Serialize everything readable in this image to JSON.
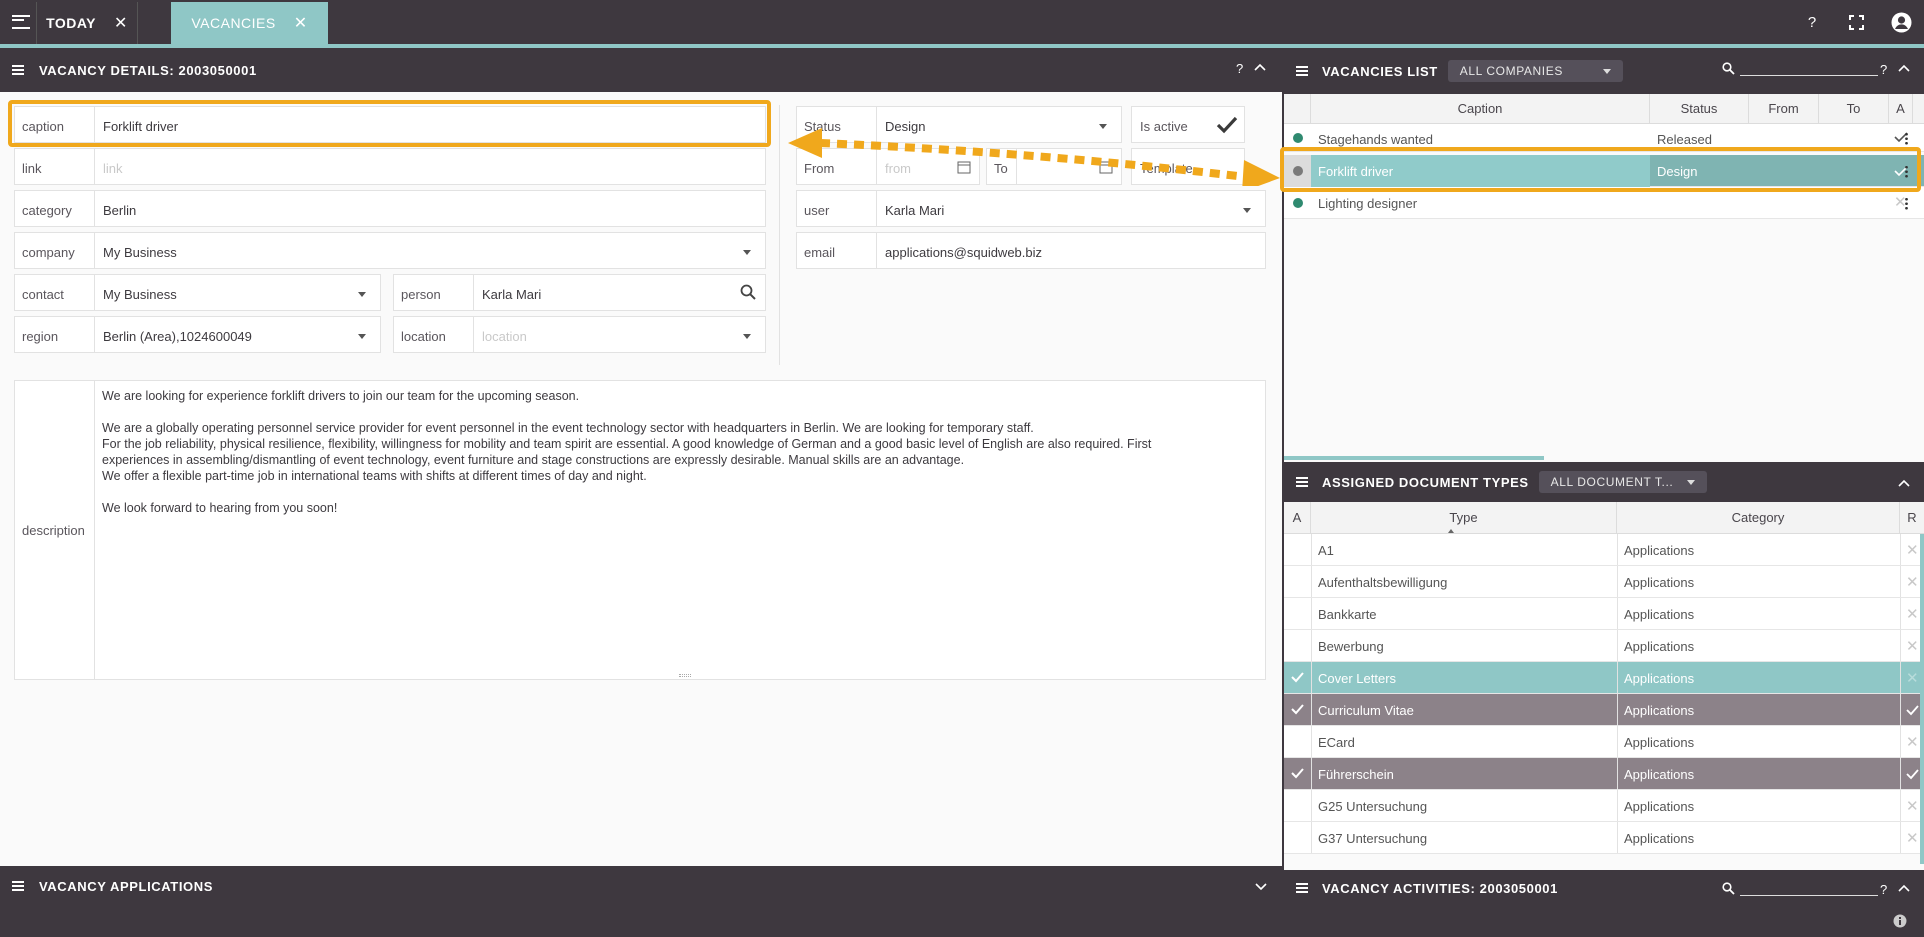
{
  "tabs": [
    {
      "label": "TODAY",
      "close": "✕",
      "active": false
    },
    {
      "label": "VACANCIES",
      "close": "✕",
      "active": true
    }
  ],
  "topbar": {
    "help": "?"
  },
  "details": {
    "title": "VACANCY DETAILS: 2003050001",
    "help": "?",
    "fields": {
      "caption": {
        "label": "caption",
        "value": "Forklift driver"
      },
      "link": {
        "label": "link",
        "placeholder": "link"
      },
      "category": {
        "label": "category",
        "value": "Berlin"
      },
      "company": {
        "label": "company",
        "value": "My Business"
      },
      "contact": {
        "label": "contact",
        "value": "My Business"
      },
      "person": {
        "label": "person",
        "value": "Karla Mari"
      },
      "region": {
        "label": "region",
        "value": "Berlin (Area),1024600049"
      },
      "location": {
        "label": "location",
        "placeholder": "location"
      },
      "status": {
        "label": "Status",
        "value": "Design"
      },
      "is_active": {
        "label": "Is active"
      },
      "from": {
        "label": "From",
        "placeholder": "from"
      },
      "to": {
        "label": "To"
      },
      "template": {
        "label": "Template"
      },
      "user": {
        "label": "user",
        "value": "Karla Mari"
      },
      "email": {
        "label": "email",
        "value": "applications@squidweb.biz"
      },
      "description": {
        "label": "description",
        "lines": [
          "We are looking for experience forklift drivers to join our team for the upcoming season.",
          "",
          "We are a globally operating personnel service provider for event personnel in the event technology sector with headquarters in Berlin. We are looking for temporary staff.",
          "For the job reliability, physical resilience, flexibility, willingness for mobility and team spirit are essential. A good knowledge of German and a good basic level of English are also required. First",
          "experiences in assembling/dismantling of event technology, event furniture and stage constructions are expressly desirable. Manual skills are an advantage.",
          "We offer a flexible part-time job in international teams with shifts at different times of day and night.",
          "",
          "We look forward to hearing from you soon!"
        ]
      }
    }
  },
  "applications": {
    "title": "VACANCY APPLICATIONS"
  },
  "vacancies": {
    "title": "VACANCIES LIST",
    "filter": "ALL COMPANIES",
    "help": "?",
    "columns": [
      "Caption",
      "Status",
      "From",
      "To",
      "A"
    ],
    "rows": [
      {
        "caption": "Stagehands wanted",
        "status": "Released",
        "dot": "#2f8a70",
        "a": true,
        "style": "partial"
      },
      {
        "caption": "Forklift driver",
        "status": "Design",
        "dot": "#7a7a7a",
        "a": true,
        "style": "selected"
      },
      {
        "caption": "Lighting designer",
        "status": "",
        "dot": "#2f8a70",
        "a": false,
        "style": "normal"
      }
    ]
  },
  "doctypes": {
    "title": "ASSIGNED DOCUMENT TYPES",
    "filter": "ALL DOCUMENT T...",
    "columns": [
      "A",
      "Type",
      "Category",
      "R"
    ],
    "rows": [
      {
        "type": "A1",
        "category": "Applications",
        "a": false,
        "r": false,
        "style": "normal"
      },
      {
        "type": "Aufenthaltsbewilligung",
        "category": "Applications",
        "a": false,
        "r": false,
        "style": "normal"
      },
      {
        "type": "Bankkarte",
        "category": "Applications",
        "a": false,
        "r": false,
        "style": "normal"
      },
      {
        "type": "Bewerbung",
        "category": "Applications",
        "a": false,
        "r": false,
        "style": "normal"
      },
      {
        "type": "Cover Letters",
        "category": "Applications",
        "a": true,
        "r": false,
        "style": "teal"
      },
      {
        "type": "Curriculum Vitae",
        "category": "Applications",
        "a": true,
        "r": true,
        "style": "gray"
      },
      {
        "type": "ECard",
        "category": "Applications",
        "a": false,
        "r": false,
        "style": "normal"
      },
      {
        "type": "Führerschein",
        "category": "Applications",
        "a": true,
        "r": true,
        "style": "gray"
      },
      {
        "type": "G25 Untersuchung",
        "category": "Applications",
        "a": false,
        "r": false,
        "style": "normal"
      },
      {
        "type": "G37 Untersuchung",
        "category": "Applications",
        "a": false,
        "r": false,
        "style": "normal"
      }
    ]
  },
  "activities": {
    "title": "VACANCY ACTIVITIES: 2003050001",
    "help": "?"
  },
  "colors": {
    "header": "#3e383f",
    "accent": "#8fc7c6",
    "highlight": "#f0a81c",
    "selected_gray": "#8c8289",
    "status_dot": "#2f8a70"
  }
}
